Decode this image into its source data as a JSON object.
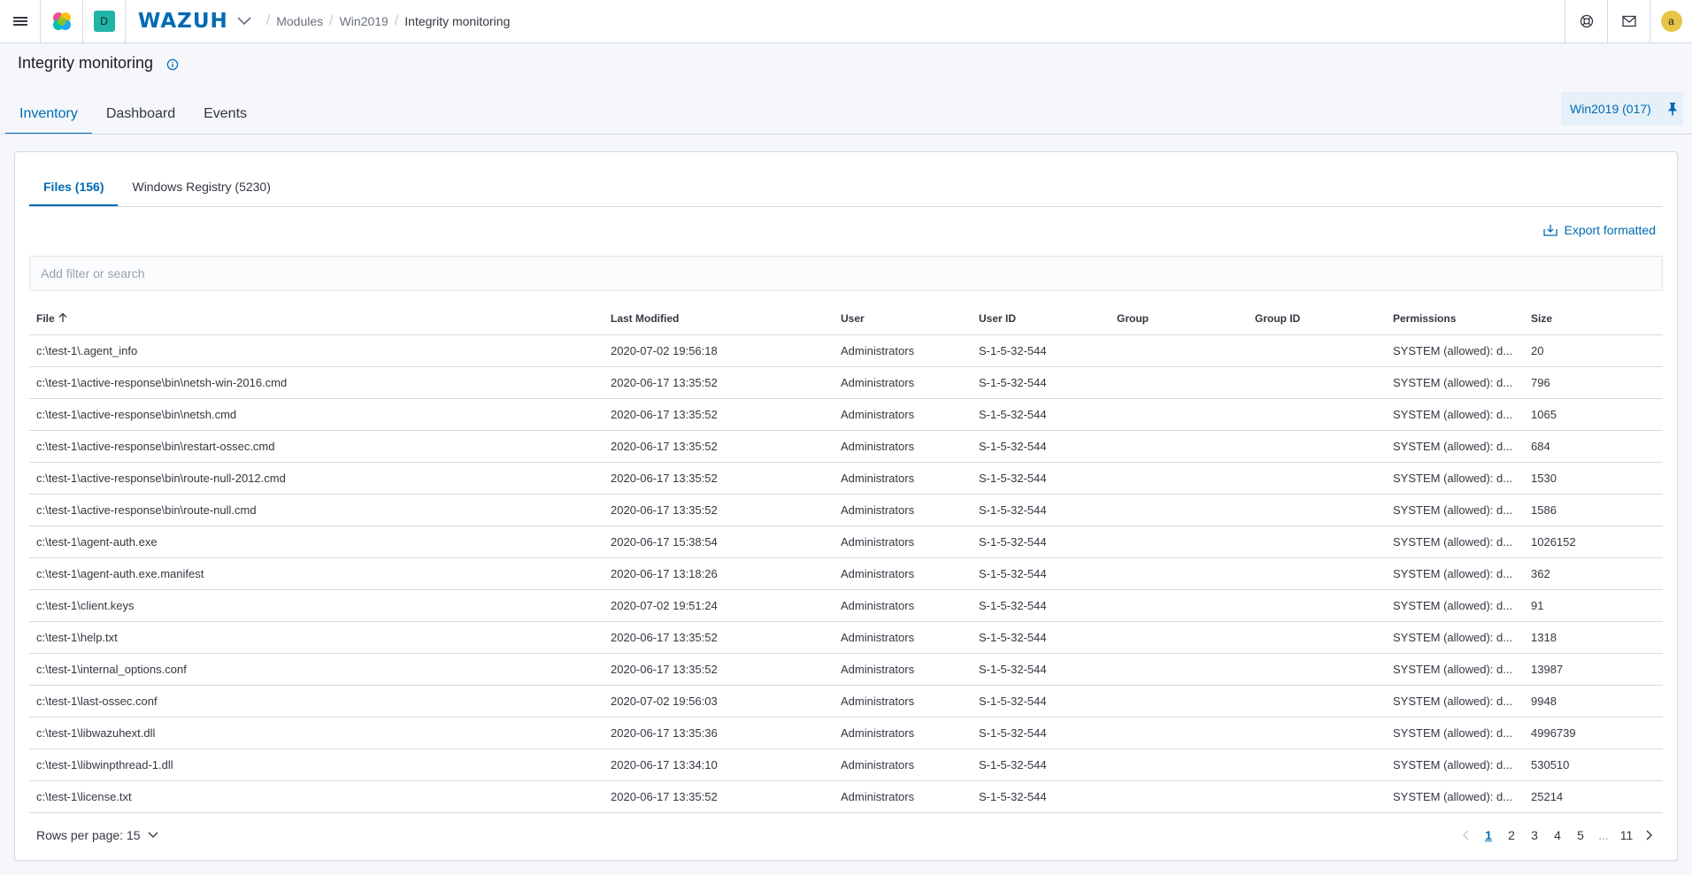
{
  "header": {
    "space_initial": "D",
    "brand": "WAZUH",
    "breadcrumbs": [
      "Modules",
      "Win2019",
      "Integrity monitoring"
    ],
    "avatar_initial": "a"
  },
  "page": {
    "title": "Integrity monitoring",
    "tabs": [
      "Inventory",
      "Dashboard",
      "Events"
    ],
    "agent_pill": "Win2019 (017)"
  },
  "panel": {
    "sub_tabs": [
      "Files (156)",
      "Windows Registry (5230)"
    ],
    "export_label": "Export formatted",
    "search_placeholder": "Add filter or search",
    "columns": [
      "File",
      "Last Modified",
      "User",
      "User ID",
      "Group",
      "Group ID",
      "Permissions",
      "Size"
    ],
    "rows": [
      [
        "c:\\test-1\\.agent_info",
        "2020-07-02 19:56:18",
        "Administrators",
        "S-1-5-32-544",
        "",
        "",
        "SYSTEM (allowed): d...",
        "20"
      ],
      [
        "c:\\test-1\\active-response\\bin\\netsh-win-2016.cmd",
        "2020-06-17 13:35:52",
        "Administrators",
        "S-1-5-32-544",
        "",
        "",
        "SYSTEM (allowed): d...",
        "796"
      ],
      [
        "c:\\test-1\\active-response\\bin\\netsh.cmd",
        "2020-06-17 13:35:52",
        "Administrators",
        "S-1-5-32-544",
        "",
        "",
        "SYSTEM (allowed): d...",
        "1065"
      ],
      [
        "c:\\test-1\\active-response\\bin\\restart-ossec.cmd",
        "2020-06-17 13:35:52",
        "Administrators",
        "S-1-5-32-544",
        "",
        "",
        "SYSTEM (allowed): d...",
        "684"
      ],
      [
        "c:\\test-1\\active-response\\bin\\route-null-2012.cmd",
        "2020-06-17 13:35:52",
        "Administrators",
        "S-1-5-32-544",
        "",
        "",
        "SYSTEM (allowed): d...",
        "1530"
      ],
      [
        "c:\\test-1\\active-response\\bin\\route-null.cmd",
        "2020-06-17 13:35:52",
        "Administrators",
        "S-1-5-32-544",
        "",
        "",
        "SYSTEM (allowed): d...",
        "1586"
      ],
      [
        "c:\\test-1\\agent-auth.exe",
        "2020-06-17 15:38:54",
        "Administrators",
        "S-1-5-32-544",
        "",
        "",
        "SYSTEM (allowed): d...",
        "1026152"
      ],
      [
        "c:\\test-1\\agent-auth.exe.manifest",
        "2020-06-17 13:18:26",
        "Administrators",
        "S-1-5-32-544",
        "",
        "",
        "SYSTEM (allowed): d...",
        "362"
      ],
      [
        "c:\\test-1\\client.keys",
        "2020-07-02 19:51:24",
        "Administrators",
        "S-1-5-32-544",
        "",
        "",
        "SYSTEM (allowed): d...",
        "91"
      ],
      [
        "c:\\test-1\\help.txt",
        "2020-06-17 13:35:52",
        "Administrators",
        "S-1-5-32-544",
        "",
        "",
        "SYSTEM (allowed): d...",
        "1318"
      ],
      [
        "c:\\test-1\\internal_options.conf",
        "2020-06-17 13:35:52",
        "Administrators",
        "S-1-5-32-544",
        "",
        "",
        "SYSTEM (allowed): d...",
        "13987"
      ],
      [
        "c:\\test-1\\last-ossec.conf",
        "2020-07-02 19:56:03",
        "Administrators",
        "S-1-5-32-544",
        "",
        "",
        "SYSTEM (allowed): d...",
        "9948"
      ],
      [
        "c:\\test-1\\libwazuhext.dll",
        "2020-06-17 13:35:36",
        "Administrators",
        "S-1-5-32-544",
        "",
        "",
        "SYSTEM (allowed): d...",
        "4996739"
      ],
      [
        "c:\\test-1\\libwinpthread-1.dll",
        "2020-06-17 13:34:10",
        "Administrators",
        "S-1-5-32-544",
        "",
        "",
        "SYSTEM (allowed): d...",
        "530510"
      ],
      [
        "c:\\test-1\\license.txt",
        "2020-06-17 13:35:52",
        "Administrators",
        "S-1-5-32-544",
        "",
        "",
        "SYSTEM (allowed): d...",
        "25214"
      ]
    ],
    "rows_per_page_label": "Rows per page: 15",
    "pagination": {
      "pages": [
        "1",
        "2",
        "3",
        "4",
        "5"
      ],
      "ellipsis": "...",
      "last_page": "11",
      "current": "1"
    }
  },
  "colors": {
    "accent": "#006bb4",
    "space_badge": "#20b4a6",
    "avatar": "#e7c547"
  }
}
